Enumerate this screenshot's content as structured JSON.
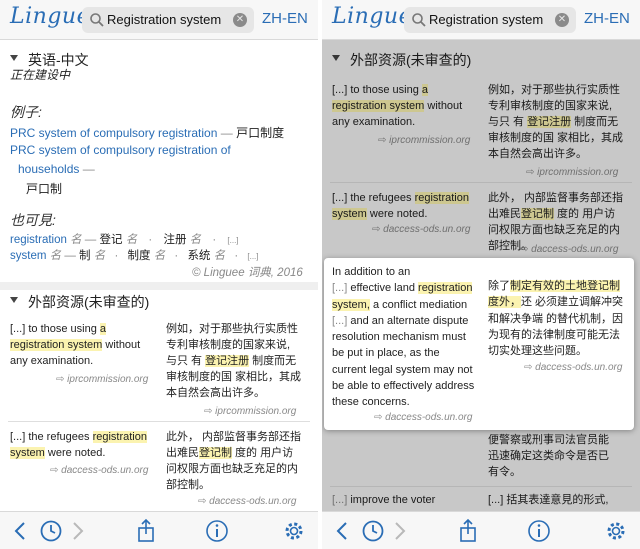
{
  "app": {
    "logo": "Linguee",
    "query": "Registration system",
    "lang": "ZH-EN"
  },
  "left": {
    "dict_header": "英语-中文",
    "dict_sub": "正在建设中",
    "examples_label": "例子:",
    "examples": [
      {
        "en": "PRC system of compulsory registration",
        "dash": "—",
        "zh": "戸口制度"
      },
      {
        "en1": "PRC system of compulsory registration of",
        "en2": "households",
        "dash": "—",
        "zh": "戸口制"
      }
    ],
    "seealso_label": "也可見:",
    "seealso": [
      {
        "w1": "registration",
        "p1": "名",
        "d1": "—",
        "w2": "登记",
        "p2": "名",
        "s": "·",
        "w3": "注册",
        "p3": "名",
        "s2": "·",
        "more": "[...]"
      },
      {
        "w1": "system",
        "p1": "名",
        "d1": "—",
        "w2": "制",
        "p2": "名",
        "s": "·",
        "w3": "制度",
        "p3": "名",
        "s2": "·",
        "w4": "系统",
        "p4": "名",
        "s3": "·",
        "more": "[...]"
      }
    ],
    "copyright": "© Linguee 词典, 2016",
    "external_header": "外部资源(未审查的)",
    "results": [
      {
        "en_pre": "[...] to those using ",
        "en_hl1": "a",
        "en_hl2": "registration system",
        "en_post": " without",
        "en_line3": "any examination.",
        "zh1": "例如，对于那些执行实质性",
        "zh2": "专利审核制度的国家来说,",
        "zh3_pre": "与只 有 ",
        "zh3_hl": "登记注册",
        "zh3_post": " 制度而无",
        "zh4": "审核制度的国 家相比，其成",
        "zh5": "本自然会高出许多。",
        "src_en": "iprcommission.org",
        "src_zh": "iprcommission.org"
      },
      {
        "en_pre": "[...] the refugees ",
        "en_hl1": "registration",
        "en_hl2": "system",
        "en_post": " were noted.",
        "zh1": "此外， 内部监督事务部还指",
        "zh2_pre": "出难民",
        "zh2_hl": "登记制",
        "zh2_post": " 度的 用户访",
        "zh3": "问权限方面也缺乏充足的内",
        "zh4": "部控制。",
        "src_en": "daccess-ods.un.org",
        "src_zh": "daccess-ods.un.org"
      }
    ]
  },
  "right": {
    "external_header": "外部资源(未审查的)",
    "popup": {
      "en1": "In addition to an",
      "en2_pre": "[...] ",
      "en2_mid": "effective land ",
      "en2_hl": "registration",
      "en3_hl": "system,",
      "en3_post": " a conflict mediation",
      "en4_pre": "[...] ",
      "en4": "and an alternate dispute",
      "en5": "resolution mechanism must",
      "en6": "be put in place, as the",
      "en7": "current legal system may not",
      "en8": "be able to effectively address",
      "en9": "these concerns.",
      "zh1_pre": "除了",
      "zh1_hl": "制定有效的土地登记制",
      "zh2_hl": "度外，",
      "zh2_post": "还 必须建立调解冲突",
      "zh3": "和解决争端 的替代机制，因",
      "zh4": "为现有的法律制度可能无法",
      "zh5": "切实处理这些问题。",
      "src_en": "daccess-ods.un.org",
      "src_zh": "daccess-ods.un.org"
    },
    "below1": "便警察或刑事司法官员能",
    "below2": "迅速确定这类命令是否已",
    "below3": "有令。",
    "bottom_en_pre": "[...] ",
    "bottom_en": "improve the voter",
    "bottom_zh": "[...] 括其表達意見的形式,"
  },
  "icons": [
    "search-icon",
    "clear-icon",
    "back-icon",
    "history-icon",
    "forward-icon",
    "share-icon",
    "info-icon",
    "gear-icon",
    "source-arrow-icon"
  ],
  "colors": {
    "link": "#2a6db5",
    "highlight": "#fbf3b0"
  }
}
